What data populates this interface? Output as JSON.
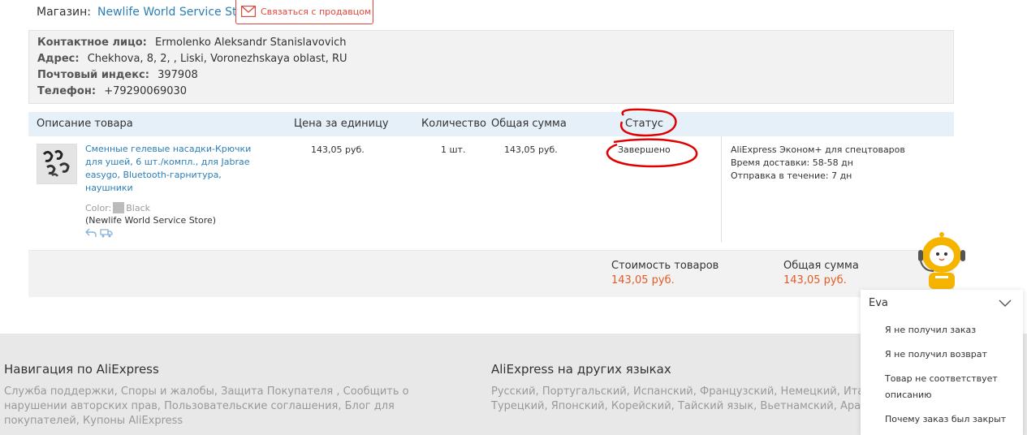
{
  "store": {
    "label": "Магазин:",
    "name": "Newlife World Service Store",
    "contact_button": "Связаться с продавцом"
  },
  "address": {
    "contact_label": "Контактное лицо:",
    "contact_value": "Ermolenko Aleksandr Stanislavovich",
    "address_label": "Адрес:",
    "address_value": "Chekhova, 8, 2, , Liski, Voronezhskaya oblast, RU",
    "zip_label": "Почтовый индекс:",
    "zip_value": "397908",
    "phone_label": "Телефон:",
    "phone_value": "+79290069030"
  },
  "table": {
    "headers": {
      "description": "Описание товара",
      "unit_price": "Цена за единицу",
      "quantity": "Количество",
      "total": "Общая сумма",
      "status": "Статус"
    },
    "row": {
      "product_name": "Сменные гелевые насадки-Крючки для ушей, 6 шт./компл., для Jabrae easygo, Bluetooth-гарнитура, наушники",
      "color_label": "Color:",
      "color_value": "Black",
      "store": "(Newlife World Service Store)",
      "unit_price": "143,05 руб.",
      "quantity": "1 шт.",
      "total": "143,05 руб.",
      "status": "Завершено",
      "shipping_method": "AliExpress Эконом+ для спецтоваров",
      "delivery_time": "Время доставки: 58-58 дн",
      "dispatch_time": "Отправка в течение: 7 дн"
    }
  },
  "totals": {
    "goods_label": "Стоимость товаров",
    "goods_value": "143,05 руб.",
    "sum_label": "Общая сумма",
    "sum_value": "143,05 руб."
  },
  "footer": {
    "nav_title": "Навигация по AliExpress",
    "nav_links": "Служба поддержки, Споры и жалобы, Защита Покупателя , Сообщить о нарушении авторских прав, Пользовательские соглашения, Блог для покупателей, Купоны AliExpress",
    "lang_title": "AliExpress на других языках",
    "lang_links_1": "Русский, Португальский, Испанский, Французский, Немецкий, Итальян",
    "lang_links_2": "Турецкий, Японский, Корейский, Тайский язык, Вьетнамский, Арабск"
  },
  "assistant": {
    "name": "Eva",
    "items": [
      "Я не получил заказ",
      "Я не получил возврат",
      "Товар не соответствует описанию",
      "Почему заказ был закрыт"
    ]
  },
  "colors": {
    "link": "#2b7fb8",
    "accent_red": "#e0473d",
    "price_orange": "#e65a23",
    "header_bg": "#e6f0f9"
  }
}
